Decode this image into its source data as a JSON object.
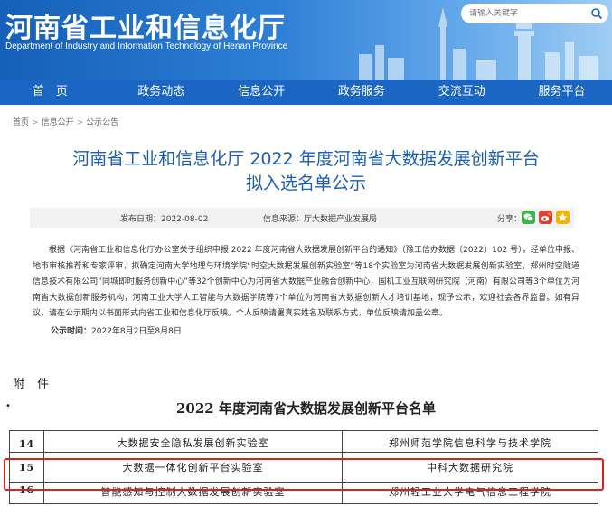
{
  "header": {
    "title": "河南省工业和信息化厅",
    "subtitle": "Department of Industry and Information Technology of Henan Province",
    "search_placeholder": "请输入关键字"
  },
  "nav": [
    {
      "label": "首　页"
    },
    {
      "label": "政务动态"
    },
    {
      "label": "信息公开"
    },
    {
      "label": "政务服务"
    },
    {
      "label": "交流互动"
    },
    {
      "label": "服务平台"
    }
  ],
  "breadcrumb": [
    "首页",
    "信息公开",
    "公示公告"
  ],
  "article": {
    "title_line1": "河南省工业和信息化厅 2022 年度河南省大数据发展创新平台",
    "title_line2": "拟入选名单公示",
    "publish_date": "发布日期：2022-08-02",
    "source": "信息来源：厅大数据产业发展局",
    "share_label": "分享：",
    "body": "根据《河南省工业和信息化厅办公室关于组织申报 2022 年度河南省大数据发展创新平台的通知》（豫工信办数据〔2022〕102 号），经单位申报、地市审核推荐和专家评审，拟确定河南大学地理与环境学院“时空大数据发展创新实验室”等18个实验室为河南省大数据发展创新实验室，郑州时空隧道信息技术有限公司“同城即时服务创新中心”等32个创新中心为河南省大数据产业融合创新中心，国机工业互联网研究院（河南）有限公司等3个单位为河南省大数据创新服务机构，河南工业大学人工智能与大数据学院等7个单位为河南省大数据创新人才培训基地，现予公示，欢迎社会各界监督。如有异议，请在公示期内以书面形式向省工业和信息化厅反映。个人反映请署真实姓名及联系方式，单位反映请加盖公章。",
    "pubtime_label": "公示时间：",
    "pubtime_value": "2022年8月2日至8月8日"
  },
  "document": {
    "annex": "附 件",
    "bullet": "•",
    "title": "2022 年度河南省大数据发展创新平台名单",
    "rows": [
      {
        "no": "14",
        "lab": "大数据安全隐私发展创新实验室",
        "unit": "郑州师范学院信息科学与技术学院"
      },
      {
        "no": "15",
        "lab": "大数据一体化创新平台实验室",
        "unit": "中科大数据研究院"
      },
      {
        "no": "16",
        "lab": "智能感知与控制大数据发展创新实验室",
        "unit": "郑州轻工业大学电气信息工程学院"
      }
    ]
  },
  "colors": {
    "brand_blue": "#1a66c2",
    "title_blue": "#1b5fb4",
    "highlight_red": "#e0201a"
  }
}
